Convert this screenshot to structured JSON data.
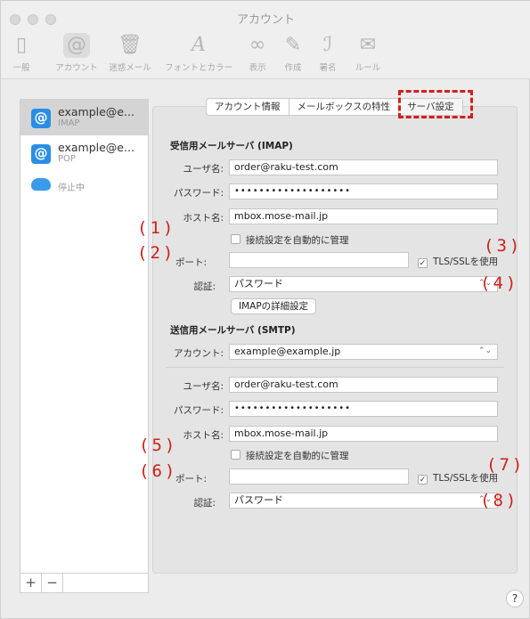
{
  "window": {
    "title": "アカウント"
  },
  "toolbar": {
    "items": [
      {
        "label": "一般",
        "icon": "phone-icon"
      },
      {
        "label": "アカウント",
        "icon": "at-icon"
      },
      {
        "label": "迷惑メール",
        "icon": "trash-icon"
      },
      {
        "label": "フォントとカラー",
        "icon": "font-icon"
      },
      {
        "label": "表示",
        "icon": "glasses-icon"
      },
      {
        "label": "作成",
        "icon": "pencil-icon"
      },
      {
        "label": "署名",
        "icon": "signature-icon"
      },
      {
        "label": "ルール",
        "icon": "rules-icon"
      }
    ]
  },
  "sidebar": {
    "accounts": [
      {
        "name": "example@e...",
        "type": "IMAP"
      },
      {
        "name": "example@e...",
        "type": "POP"
      }
    ],
    "cloud_label": "停止中",
    "add": "+",
    "remove": "−"
  },
  "tabs": [
    "アカウント情報",
    "メールボックスの特性",
    "サーバ設定"
  ],
  "incoming": {
    "heading": "受信用メールサーバ (IMAP)",
    "username_label": "ユーザ名:",
    "username": "order@raku-test.com",
    "password_label": "パスワード:",
    "password": "•••••••••••••••••••",
    "host_label": "ホスト名:",
    "host": "mbox.mose-mail.jp",
    "auto_label": "接続設定を自動的に管理",
    "port_label": "ポート:",
    "port": "",
    "tls_label": "TLS/SSLを使用",
    "auth_label": "認証:",
    "auth": "パスワード",
    "advanced_button": "IMAPの詳細設定"
  },
  "outgoing": {
    "heading": "送信用メールサーバ (SMTP)",
    "account_label": "アカウント:",
    "account": "example@example.jp",
    "username_label": "ユーザ名:",
    "username": "order@raku-test.com",
    "password_label": "パスワード:",
    "password": "•••••••••••••••••••",
    "host_label": "ホスト名:",
    "host": "mbox.mose-mail.jp",
    "auto_label": "接続設定を自動的に管理",
    "port_label": "ポート:",
    "port": "",
    "tls_label": "TLS/SSLを使用",
    "auth_label": "認証:",
    "auth": "パスワード"
  },
  "annotations": [
    "(1)",
    "(2)",
    "(3)",
    "(4)",
    "(5)",
    "(6)",
    "(7)",
    "(8)"
  ],
  "help": "?",
  "colors": {
    "annotation": "#d0201a",
    "accent": "#2b8ee6"
  }
}
